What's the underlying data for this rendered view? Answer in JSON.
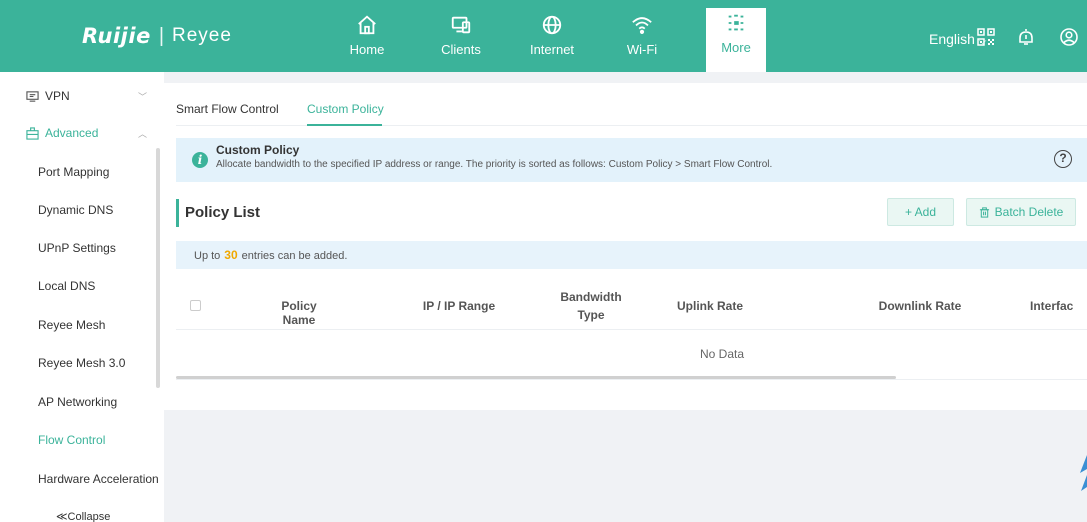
{
  "brand": {
    "name1": "Ruijie",
    "separator": "|",
    "name2": "Reyee"
  },
  "nav": [
    {
      "label": "Home",
      "icon": "home-icon"
    },
    {
      "label": "Clients",
      "icon": "clients-icon"
    },
    {
      "label": "Internet",
      "icon": "globe-icon"
    },
    {
      "label": "Wi-Fi",
      "icon": "wifi-icon"
    },
    {
      "label": "More",
      "icon": "more-icon",
      "active": true
    }
  ],
  "topright": {
    "language": "English",
    "qr_icon": "qr-code-icon",
    "alert_icon": "alert-icon",
    "user_icon": "user-icon"
  },
  "sidebar": {
    "items": [
      {
        "label": "VPN",
        "level": "top"
      },
      {
        "label": "Advanced",
        "level": "top"
      },
      {
        "label": "Port Mapping"
      },
      {
        "label": "Dynamic DNS"
      },
      {
        "label": "UPnP Settings"
      },
      {
        "label": "Local DNS"
      },
      {
        "label": "Reyee Mesh"
      },
      {
        "label": "Reyee Mesh 3.0"
      },
      {
        "label": "AP Networking"
      },
      {
        "label": "Flow Control",
        "active": true
      },
      {
        "label": "Hardware Acceleration"
      }
    ],
    "collapse_label": "≪Collapse"
  },
  "tabs": [
    {
      "label": "Smart Flow Control"
    },
    {
      "label": "Custom Policy",
      "active": true
    }
  ],
  "info": {
    "title": "Custom Policy",
    "text": "Allocate bandwidth to the specified IP address or range. The priority is sorted as follows: Custom Policy > Smart Flow Control.",
    "help_icon": "?"
  },
  "section": {
    "title": "Policy List"
  },
  "buttons": {
    "add": "+ Add",
    "batch_delete": "Batch Delete"
  },
  "limit": {
    "prefix": "Up to",
    "count": "30",
    "suffix": "entries can be added."
  },
  "table": {
    "headers": [
      "Policy Name",
      "IP / IP Range",
      "Bandwidth",
      "Type",
      "Uplink Rate",
      "Downlink Rate",
      "Interfac"
    ],
    "empty_text": "No Data"
  },
  "colors": {
    "accent": "#3bb39a",
    "info_bg": "#e3f2fb",
    "warn": "#f0a800"
  }
}
